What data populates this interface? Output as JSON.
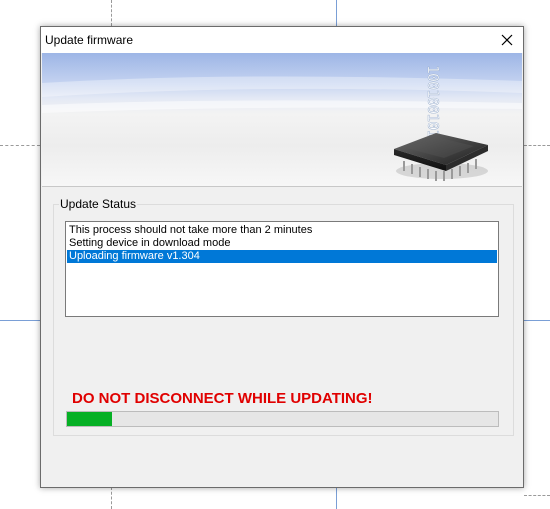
{
  "window": {
    "title": "Update firmware",
    "close_icon": "close-icon"
  },
  "banner": {
    "binary_text": "100100101011",
    "icon": "microchip-icon"
  },
  "status_group": {
    "label": "Update Status",
    "log_items": [
      "This process should not take more than 2 minutes",
      "Setting device in download mode",
      "Uploading firmware v1.304"
    ],
    "selected_index": 2
  },
  "warning": {
    "text": "DO NOT DISCONNECT WHILE UPDATING!",
    "color": "#e00000"
  },
  "progress": {
    "fraction": 0.105,
    "fill_color": "#06b025"
  },
  "colors": {
    "selection": "#0078d7",
    "dialog_bg": "#f0f0f0"
  }
}
